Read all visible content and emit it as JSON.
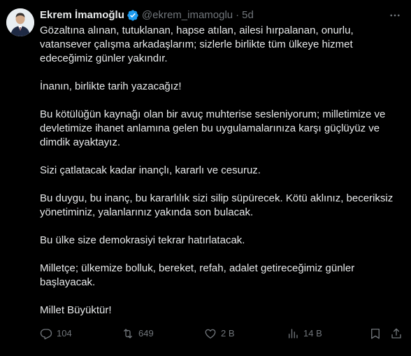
{
  "author": {
    "display_name": "Ekrem İmamoğlu",
    "handle": "@ekrem_imamoglu",
    "separator": "·",
    "time": "5d",
    "verified": true
  },
  "tweet": {
    "paragraphs": [
      "Gözaltına alınan, tutuklanan, hapse atılan, ailesi hırpalanan, onurlu, vatansever çalışma arkadaşlarım; sizlerle birlikte tüm ülkeye hizmet edeceğimiz günler yakındır.",
      "İnanın, birlikte tarih yazacağız!",
      "Bu kötülüğün kaynağı olan bir avuç muhterise sesleniyorum; milletimize ve devletimize ihanet anlamına gelen bu uygulamalarınıza karşı güçlüyüz ve dimdik ayaktayız.",
      "Sizi çatlatacak kadar inançlı, kararlı ve cesuruz.",
      "Bu duygu, bu inanç, bu kararlılık sizi silip süpürecek. Kötü aklınız, beceriksiz yönetiminiz, yalanlarınız yakında son bulacak.",
      "Bu ülke size demokrasiyi tekrar hatırlatacak.",
      "Milletçe; ülkemize bolluk, bereket, refah, adalet getireceğimiz günler başlayacak.",
      "Millet Büyüktür!"
    ]
  },
  "actions": {
    "reply_count": "104",
    "retweet_count": "649",
    "like_count": "2 B",
    "views_count": "14 B"
  },
  "icons": {
    "verified": "verified-badge-icon",
    "more": "more-dots-icon",
    "reply": "reply-icon",
    "retweet": "retweet-icon",
    "like": "heart-icon",
    "views": "views-chart-icon",
    "bookmark": "bookmark-icon",
    "share": "share-icon"
  },
  "colors": {
    "background": "#000000",
    "text": "#e7e9ea",
    "muted": "#71767b",
    "verified": "#1d9bf0"
  }
}
